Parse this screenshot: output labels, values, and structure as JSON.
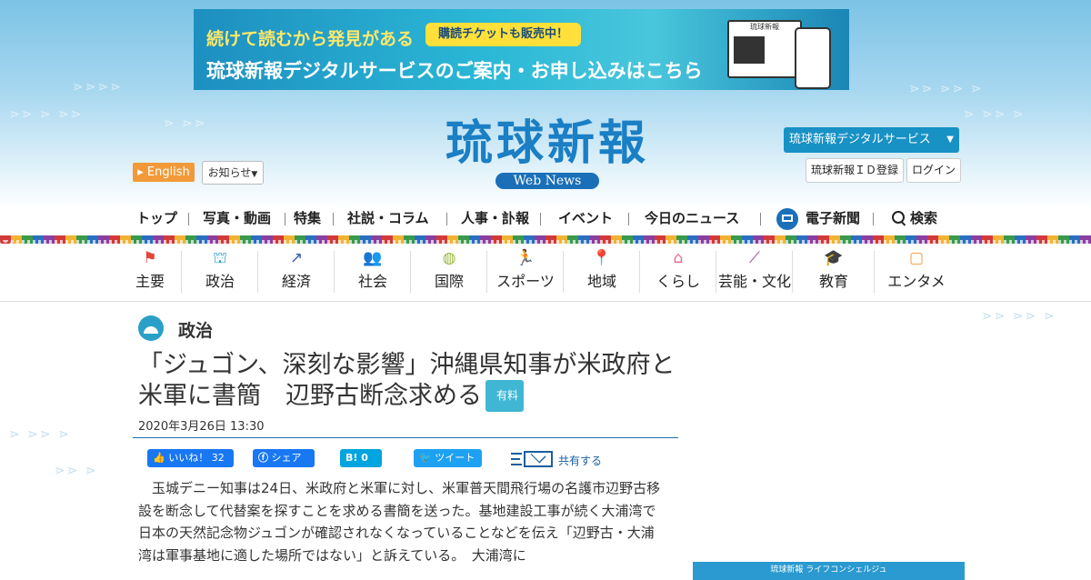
{
  "banner": {
    "line1": "続けて読むから発見がある",
    "pill": "購読チケットも販売中！",
    "line2": "琉球新報デジタルサービスのご案内・お申し込みはこちら",
    "mock_title": "琉球新報"
  },
  "logo": {
    "title": "琉球新報",
    "sub": "Web News"
  },
  "header": {
    "english": "English",
    "notice": "お知らせ",
    "digital_service": "琉球新報デジタルサービス",
    "id_register": "琉球新報ＩＤ登録",
    "login": "ログイン"
  },
  "main_nav": [
    {
      "label": "トップ"
    },
    {
      "label": "写真・動画"
    },
    {
      "label": "特集"
    },
    {
      "label": "社説・コラム"
    },
    {
      "label": "人事・訃報"
    },
    {
      "label": "イベント"
    },
    {
      "label": "今日のニュース"
    },
    {
      "label": "電子新聞"
    },
    {
      "label": "検索"
    }
  ],
  "categories": [
    {
      "label": "主要",
      "icon": "flag-icon",
      "color": "#e0463c"
    },
    {
      "label": "政治",
      "icon": "parliament-icon",
      "color": "#2aa0c8"
    },
    {
      "label": "経済",
      "icon": "trend-icon",
      "color": "#3a5ea8"
    },
    {
      "label": "社会",
      "icon": "people-icon",
      "color": "#3a7ec8"
    },
    {
      "label": "国際",
      "icon": "globe-icon",
      "color": "#9ab83a"
    },
    {
      "label": "スポーツ",
      "icon": "runner-icon",
      "color": "#e0463c"
    },
    {
      "label": "地域",
      "icon": "pin-icon",
      "color": "#6cc04a"
    },
    {
      "label": "くらし",
      "icon": "house-icon",
      "color": "#e86a8a"
    },
    {
      "label": "芸能・文化",
      "icon": "sanshin-icon",
      "color": "#8a3fa0"
    },
    {
      "label": "教育",
      "icon": "graduation-cap-icon",
      "color": "#e0b030"
    },
    {
      "label": "エンタメ",
      "icon": "tv-icon",
      "color": "#f29a3a"
    }
  ],
  "article": {
    "section": "政治",
    "headline": "「ジュゴン、深刻な影響」沖縄県知事が米政府と米軍に書簡　辺野古断念求める",
    "paid_badge": "有料",
    "date": "2020年3月26日 13:30",
    "share": {
      "like": "いいね！ 32",
      "fb_share": "シェア",
      "hatena": "B! 0",
      "tweet": "ツイート",
      "share": "共有する"
    },
    "body": "　玉城デニー知事は24日、米政府と米軍に対し、米軍普天間飛行場の名護市辺野古移設を断念して代替案を探すことを求める書簡を送った。基地建設工事が続く大浦湾で日本の天然記念物ジュゴンが確認されなくなっていることなどを伝え「辺野古・大浦湾は軍事基地に適した場所ではない」と訴えている。　大浦湾に"
  },
  "sidebar": {
    "concierge": "琉球新報 ライフコンシェルジュ"
  }
}
